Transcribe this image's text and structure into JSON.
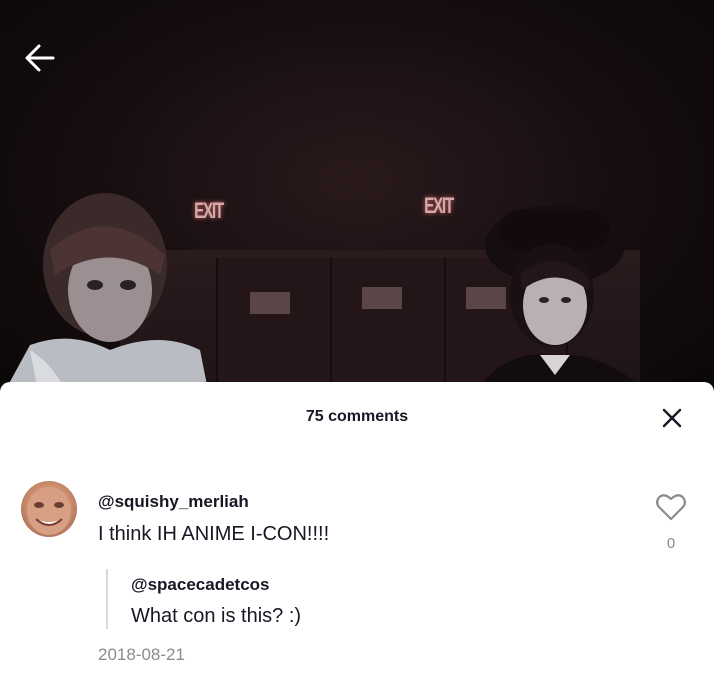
{
  "video": {
    "exit_signs": [
      "EXIT",
      "EXIT"
    ]
  },
  "header": {
    "back_icon": "arrow-left-icon"
  },
  "comments_sheet": {
    "title": "75 comments",
    "close_icon": "close-icon"
  },
  "comment": {
    "username": "@squishy_merliah",
    "text": "I think IH ANIME I-CON!!!!",
    "like_icon": "heart-icon",
    "like_count": "0",
    "date": "2018-08-21",
    "reply": {
      "username": "@spacecadetcos",
      "text": "What con is this? :)"
    }
  }
}
